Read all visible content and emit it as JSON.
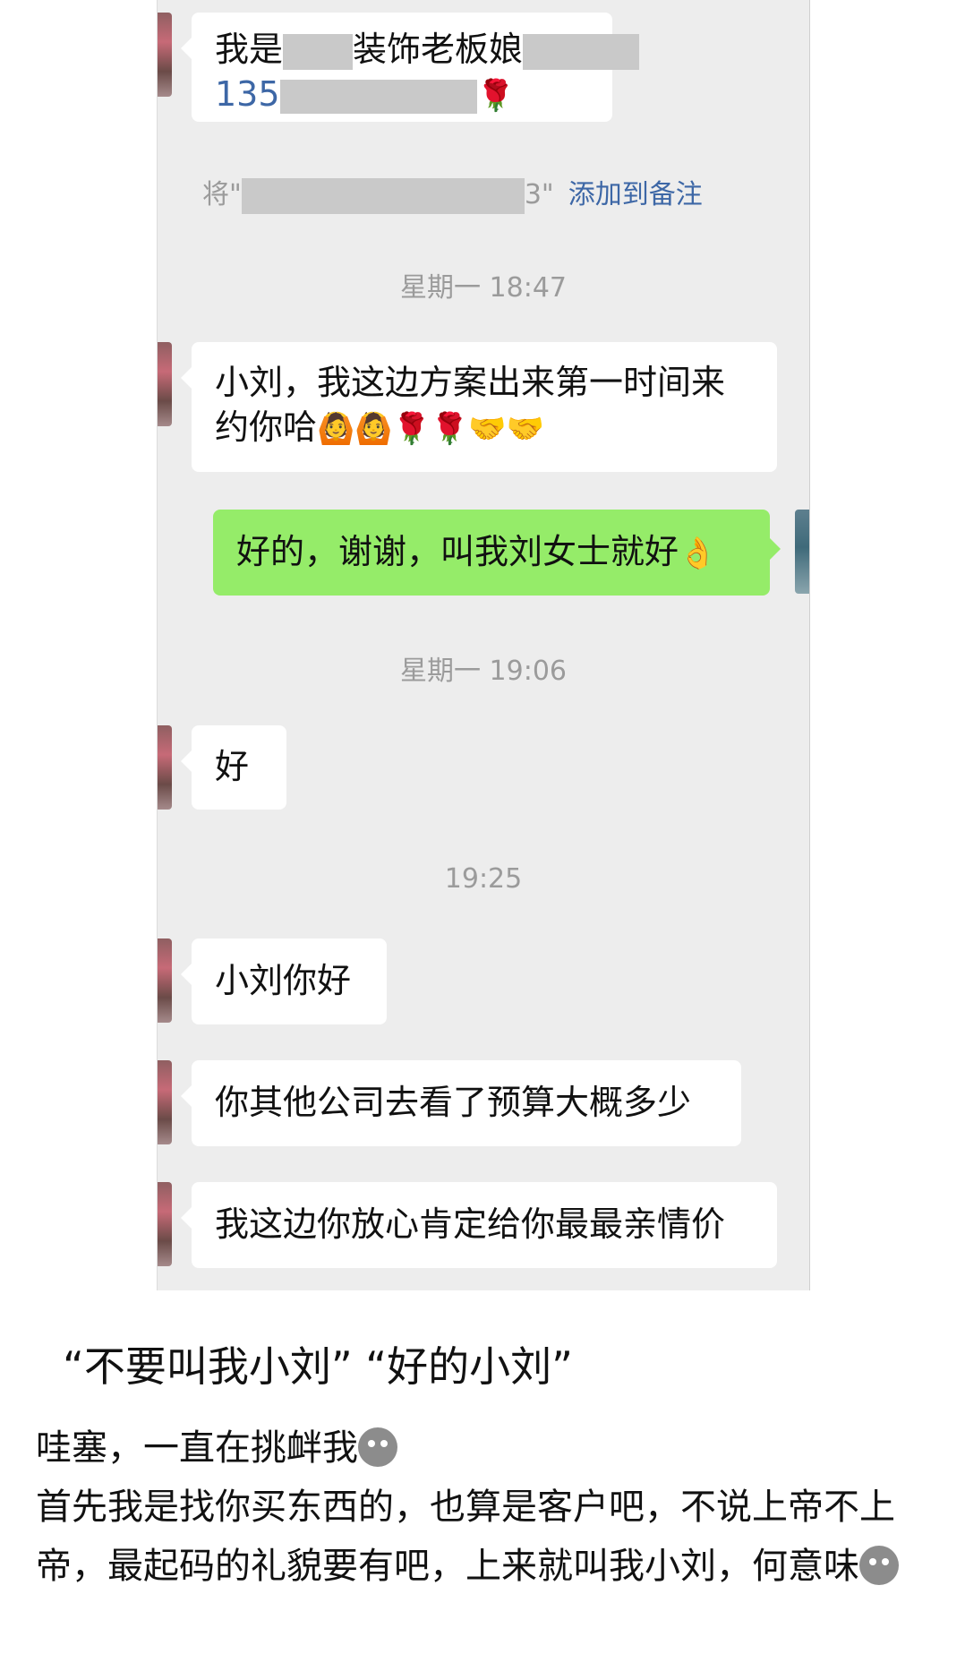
{
  "chat": {
    "msg1": {
      "line1_prefix": "我是",
      "line1_mid": "装饰老板娘",
      "line2_prefix": "135"
    },
    "remark": {
      "prefix": "将\"",
      "suffix": "3\"",
      "link": "添加到备注"
    },
    "time1": "星期一 18:47",
    "msg2": {
      "text": "小刘，我这边方案出来第一时间来约你哈"
    },
    "msg3": {
      "text": "好的，谢谢，叫我刘女士就好"
    },
    "time2": "星期一 19:06",
    "msg4": {
      "text": "好"
    },
    "time3": "19:25",
    "msg5": {
      "text": "小刘你好"
    },
    "msg6": {
      "text": "你其他公司去看了预算大概多少"
    },
    "msg7": {
      "text": "我这边你放心肯定给你最最亲情价"
    }
  },
  "caption": {
    "quote": "“不要叫我小刘”  “好的小刘”",
    "line1": "哇塞，一直在挑衅我",
    "line2": "首先我是找你买东西的，也算是客户吧，不说上帝不上帝，最起码的礼貌要有吧，上来就叫我小刘，何意味"
  },
  "colors": {
    "chat_bg": "#ededed",
    "bubble_self": "#95ec69",
    "bubble_other": "#ffffff",
    "link": "#3d67a6"
  },
  "icons": [
    "rose-emoji",
    "thumbs-person-emoji",
    "handshake-emoji",
    "ok-hand-emoji",
    "gray-face-emoji"
  ]
}
